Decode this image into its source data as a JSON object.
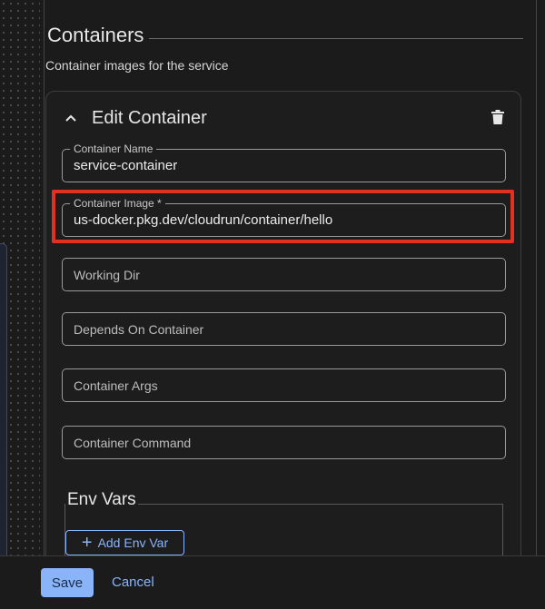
{
  "section": {
    "title": "Containers",
    "subtitle": "Container images for the service"
  },
  "card": {
    "title": "Edit Container",
    "collapse_icon": "chevron-up-icon",
    "delete_icon": "trash-icon"
  },
  "fields": {
    "container_name": {
      "label": "Container Name",
      "value": "service-container"
    },
    "container_image": {
      "label": "Container Image *",
      "value": "us-docker.pkg.dev/cloudrun/container/hello"
    },
    "working_dir": {
      "placeholder": "Working Dir"
    },
    "depends_on": {
      "placeholder": "Depends On Container"
    },
    "args": {
      "placeholder": "Container Args"
    },
    "command": {
      "placeholder": "Container Command"
    }
  },
  "env": {
    "title": "Env Vars",
    "add_label": "Add Env Var",
    "add_icon": "plus-icon"
  },
  "footer": {
    "save_label": "Save",
    "cancel_label": "Cancel"
  },
  "colors": {
    "accent": "#8ab4f8",
    "highlight": "#e0321f",
    "background": "#1b1b1c"
  }
}
